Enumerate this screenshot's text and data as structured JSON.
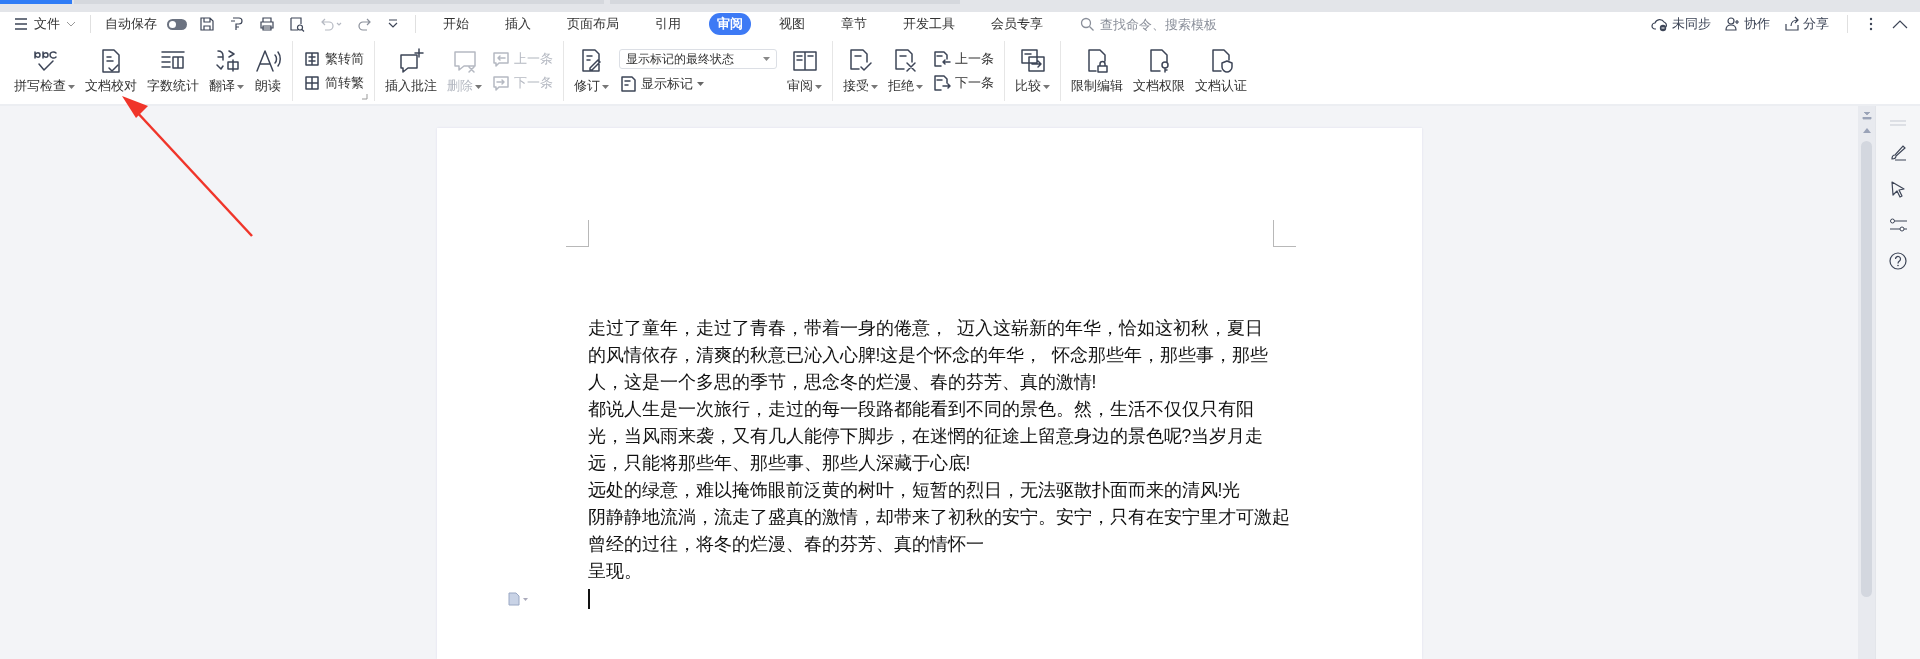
{
  "menu": {
    "file": "文件",
    "autosave": {
      "label": "自动保存",
      "on": false
    },
    "tabs": [
      {
        "label": "开始",
        "selected": false
      },
      {
        "label": "插入",
        "selected": false
      },
      {
        "label": "页面布局",
        "selected": false
      },
      {
        "label": "引用",
        "selected": false
      },
      {
        "label": "审阅",
        "selected": true
      },
      {
        "label": "视图",
        "selected": false
      },
      {
        "label": "章节",
        "selected": false
      },
      {
        "label": "开发工具",
        "selected": false
      },
      {
        "label": "会员专享",
        "selected": false
      }
    ],
    "search": {
      "placeholder": "查找命令、搜索模板"
    },
    "actions": [
      "未同步",
      "协作",
      "分享"
    ]
  },
  "ribbon": {
    "groups": [
      {
        "items": [
          {
            "kind": "large",
            "label": "拼写检查",
            "caret": true,
            "disabled": false
          },
          {
            "kind": "large",
            "label": "文档校对",
            "disabled": false
          },
          {
            "kind": "large",
            "label": "字数统计",
            "disabled": false
          },
          {
            "kind": "large",
            "label": "翻译",
            "caret": true,
            "disabled": false
          },
          {
            "kind": "large",
            "label": "朗读",
            "disabled": false
          }
        ]
      },
      {
        "launcher": true,
        "items": [
          {
            "kind": "pair",
            "items": [
              {
                "label": "繁转简",
                "disabled": false
              },
              {
                "label": "简转繁",
                "disabled": false
              }
            ]
          }
        ]
      },
      {
        "items": [
          {
            "kind": "large",
            "label": "插入批注",
            "disabled": false
          },
          {
            "kind": "large",
            "label": "删除",
            "caret": true,
            "disabled": true
          },
          {
            "kind": "pair",
            "items": [
              {
                "label": "上一条",
                "disabled": true
              },
              {
                "label": "下一条",
                "disabled": true
              }
            ]
          }
        ]
      },
      {
        "items": [
          {
            "kind": "large",
            "label": "修订",
            "caret": true,
            "disabled": false
          },
          {
            "kind": "markup",
            "select": "显示标记的最终状态",
            "label": "显示标记",
            "caret": true
          },
          {
            "kind": "large",
            "label": "审阅",
            "caret": true,
            "disabled": false
          }
        ]
      },
      {
        "items": [
          {
            "kind": "large",
            "label": "接受",
            "caret": true,
            "disabled": false
          },
          {
            "kind": "large",
            "label": "拒绝",
            "caret": true,
            "disabled": false
          },
          {
            "kind": "pair",
            "items": [
              {
                "label": "上一条",
                "disabled": false
              },
              {
                "label": "下一条",
                "disabled": false
              }
            ]
          }
        ]
      },
      {
        "items": [
          {
            "kind": "large",
            "label": "比较",
            "caret": true,
            "disabled": false
          }
        ]
      },
      {
        "items": [
          {
            "kind": "large",
            "label": "限制编辑",
            "disabled": false
          },
          {
            "kind": "large",
            "label": "文档权限",
            "disabled": false
          },
          {
            "kind": "large",
            "label": "文档认证",
            "disabled": false
          }
        ]
      }
    ]
  },
  "document": {
    "lines": [
      "走过了童年，走过了青春，带着一身的倦意，  迈入这崭新的年华，恰如这初秋，夏日",
      "的风情依存，清爽的秋意已沁入心脾!这是个怀念的年华，  怀念那些年，那些事，那些",
      "人，这是一个多思的季节，思念冬的烂漫、春的芬芳、真的激情!",
      "都说人生是一次旅行，走过的每一段路都能看到不同的景色。然，生活不仅仅只有阳",
      "光，当风雨来袭，又有几人能停下脚步，在迷惘的征途上留意身边的景色呢?当岁月走",
      "远，只能将那些年、那些事、那些人深藏于心底!",
      "远处的绿意，难以掩饰眼前泛黄的树叶，短暂的烈日，无法驱散扑面而来的清风!光",
      "阴静静地流淌，流走了盛真的激情，却带来了初秋的安宁。安宁，只有在安宁里才可激起",
      "曾经的过往，将冬的烂漫、春的芬芳、真的情怀一",
      "呈现。"
    ]
  }
}
